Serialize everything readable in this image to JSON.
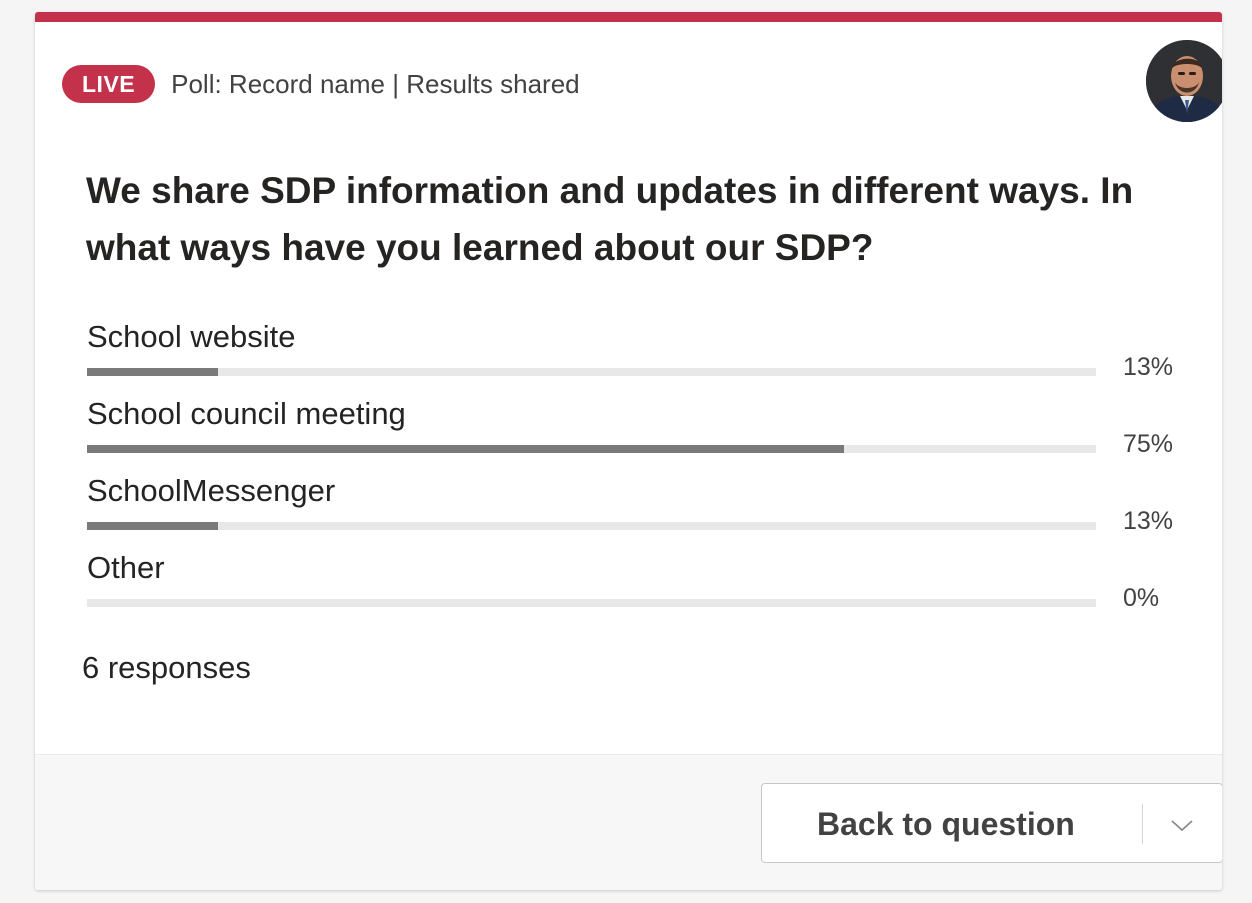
{
  "colors": {
    "accent": "#c4314b",
    "bar_fill": "#7a7a7a",
    "bar_track": "#e8e8e8"
  },
  "header": {
    "live_label": "LIVE",
    "poll_meta": "Poll: Record name | Results shared",
    "avatar_icon": "user-avatar-photo"
  },
  "question": "We share SDP information and updates in different ways. In what ways have you learned about our SDP?",
  "options": [
    {
      "label": "School website",
      "percent_text": "13%",
      "fill_fraction": 0.13
    },
    {
      "label": "School council meeting",
      "percent_text": "75%",
      "fill_fraction": 0.75
    },
    {
      "label": "SchoolMessenger",
      "percent_text": "13%",
      "fill_fraction": 0.13
    },
    {
      "label": "Other",
      "percent_text": "0%",
      "fill_fraction": 0
    }
  ],
  "responses": "6 responses",
  "footer": {
    "back_button": "Back to question",
    "dropdown_icon": "chevron-down-icon"
  }
}
